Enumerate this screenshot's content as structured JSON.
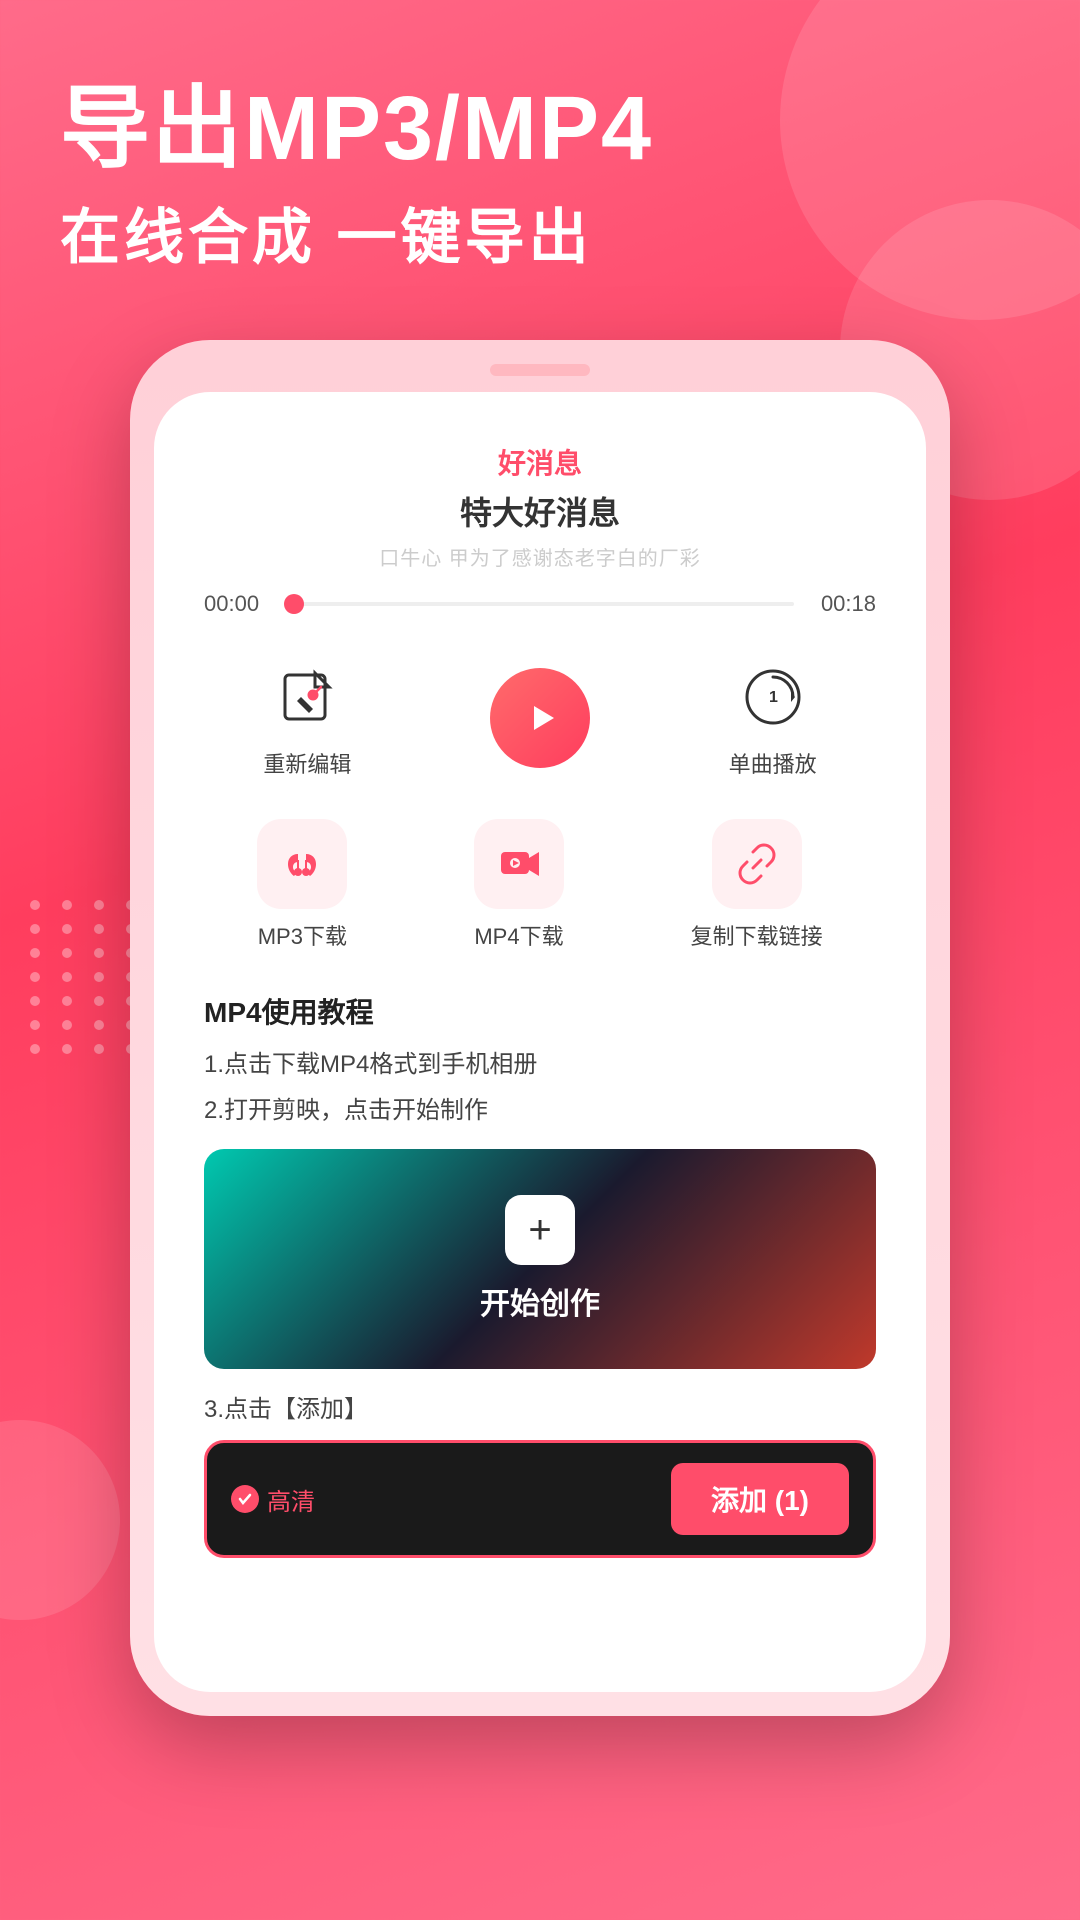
{
  "header": {
    "title": "导出MP3/MP4",
    "subtitle": "在线合成 一键导出"
  },
  "screen": {
    "good_news_label": "好消息",
    "song_title": "特大好消息",
    "song_desc": "口牛心 甲为了感谢态老字白的厂彩",
    "time_start": "00:00",
    "time_end": "00:18",
    "action1_label": "重新编辑",
    "action2_label": "",
    "action3_label": "单曲播放",
    "mp3_label": "MP3下载",
    "mp4_label": "MP4下载",
    "copy_label": "复制下载链接",
    "tutorial_title": "MP4使用教程",
    "step1": "1.点击下载MP4格式到手机相册",
    "step2": "2.打开剪映，点击开始制作",
    "video_btn_label": "开始创作",
    "step3": "3.点击【添加】",
    "hd_label": "高清",
    "add_btn_label": "添加 (1)"
  },
  "colors": {
    "primary": "#ff4d6a",
    "bg_gradient_start": "#ff6b8a",
    "bg_gradient_end": "#ff3d5e",
    "icon_bg": "#fff0f2"
  }
}
